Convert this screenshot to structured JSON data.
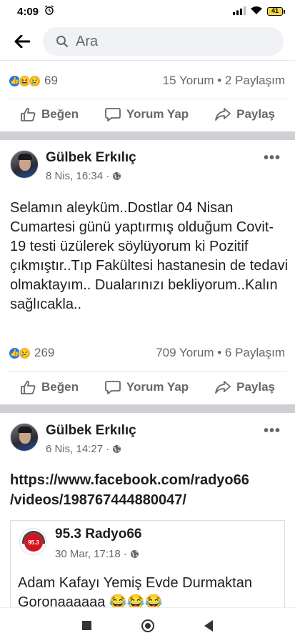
{
  "status_bar": {
    "time": "4:09",
    "battery": "41"
  },
  "header": {
    "search_placeholder": "Ara"
  },
  "post0": {
    "reaction_count": "69",
    "comments_shares": "15 Yorum • 2 Paylaşım"
  },
  "actions": {
    "like": "Beğen",
    "comment": "Yorum Yap",
    "share": "Paylaş"
  },
  "post1": {
    "author": "Gülbek Erkılıç",
    "date": "8 Nis, 16:34 ·",
    "text": "Selamın aleyküm..Dostlar 04 Nisan Cumartesi günü  yaptırmış olduğum Covit-19 testi üzülerek söylüyorum ki Pozitif çıkmıştır..Tıp Fakültesi hastanesin de tedavi olmaktayım.. Dualarınızı bekliyorum..Kalın sağlıcakla..",
    "reaction_count": "269",
    "comments_shares": "709 Yorum • 6 Paylaşım"
  },
  "post2": {
    "author": "Gülbek Erkılıç",
    "date": "6 Nis, 14:27 ·",
    "link_line1": "https://www.facebook.com/radyo66",
    "link_line2": "/videos/198767444880047/",
    "shared": {
      "name": "95.3 Radyo66",
      "logo_text": "95.3",
      "date": "30 Mar, 17:18 ·",
      "text": "Adam Kafayı Yemiş Evde Durmaktan Goronaaaaaa 😂😂😂"
    }
  },
  "icons": {
    "reactions_post0": [
      "like-reaction",
      "haha-reaction",
      "sad-reaction"
    ],
    "reactions_post1": [
      "like-reaction",
      "sad-reaction"
    ]
  }
}
